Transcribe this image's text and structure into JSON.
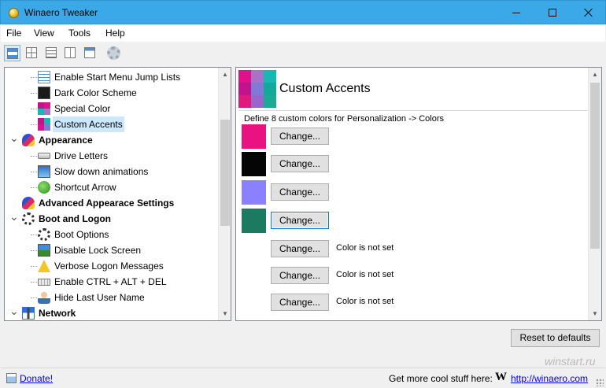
{
  "window": {
    "title": "Winaero Tweaker",
    "controls": {
      "minimize": "minimize-icon",
      "maximize": "maximize-icon",
      "close": "close-icon"
    }
  },
  "menu": [
    "File",
    "View",
    "Tools",
    "Help"
  ],
  "toolbar": {
    "buttons": [
      "view-details-icon",
      "view-grid-icon",
      "view-list-icon",
      "view-tiles-icon",
      "view-content-icon",
      "settings-gear-icon"
    ],
    "active_index": 0
  },
  "tree": {
    "items": [
      {
        "label": "Enable Start Menu Jump Lists",
        "level": 2,
        "icon": "checklist-icon"
      },
      {
        "label": "Dark Color Scheme",
        "level": 2,
        "icon": "dark-scheme-icon"
      },
      {
        "label": "Special Color",
        "level": 2,
        "icon": "color-palette-icon"
      },
      {
        "label": "Custom Accents",
        "level": 2,
        "icon": "accents-grid-icon",
        "selected": true
      },
      {
        "label": "Appearance",
        "level": 1,
        "icon": "appearance-icon",
        "expanded": true
      },
      {
        "label": "Drive Letters",
        "level": 2,
        "icon": "drive-icon"
      },
      {
        "label": "Slow down animations",
        "level": 2,
        "icon": "monitor-icon"
      },
      {
        "label": "Shortcut Arrow",
        "level": 2,
        "icon": "shortcut-arrow-icon"
      },
      {
        "label": "Advanced Appearace Settings",
        "level": 1,
        "icon": "appearance-icon"
      },
      {
        "label": "Boot and Logon",
        "level": 1,
        "icon": "spinner-icon",
        "expanded": true
      },
      {
        "label": "Boot Options",
        "level": 2,
        "icon": "spinner-icon"
      },
      {
        "label": "Disable Lock Screen",
        "level": 2,
        "icon": "landscape-icon"
      },
      {
        "label": "Verbose Logon Messages",
        "level": 2,
        "icon": "warning-icon"
      },
      {
        "label": "Enable CTRL + ALT + DEL",
        "level": 2,
        "icon": "keyboard-icon"
      },
      {
        "label": "Hide Last User Name",
        "level": 2,
        "icon": "user-icon"
      },
      {
        "label": "Network",
        "level": 1,
        "icon": "network-icon",
        "expanded": true
      }
    ],
    "scroll_position": 0.4
  },
  "panel": {
    "title": "Custom Accents",
    "header_icon_colors": [
      "#e0118a",
      "#a872c6",
      "#16b8b2",
      "#c0148c",
      "#7e7ad6",
      "#12a89a",
      "#e01a7d",
      "#9966cc",
      "#1aaa96"
    ],
    "description": "Define 8 custom colors for Personalization -> Colors",
    "colors": [
      {
        "swatch": "#ea1180",
        "button": "Change...",
        "status": ""
      },
      {
        "swatch": "#050505",
        "button": "Change...",
        "status": ""
      },
      {
        "swatch": "#8b80ff",
        "button": "Change...",
        "status": ""
      },
      {
        "swatch": "#1c7a60",
        "button": "Change...",
        "status": "",
        "focused": true
      },
      {
        "swatch": "",
        "button": "Change...",
        "status": "Color is not set"
      },
      {
        "swatch": "",
        "button": "Change...",
        "status": "Color is not set"
      },
      {
        "swatch": "",
        "button": "Change...",
        "status": "Color is not set"
      }
    ]
  },
  "reset_button": "Reset to defaults",
  "status_bar": {
    "donate_link": "Donate!",
    "promo_text": "Get more cool stuff here:",
    "logo_letter": "W",
    "site_link": "http://winaero.com"
  },
  "watermark": "winstart.ru"
}
